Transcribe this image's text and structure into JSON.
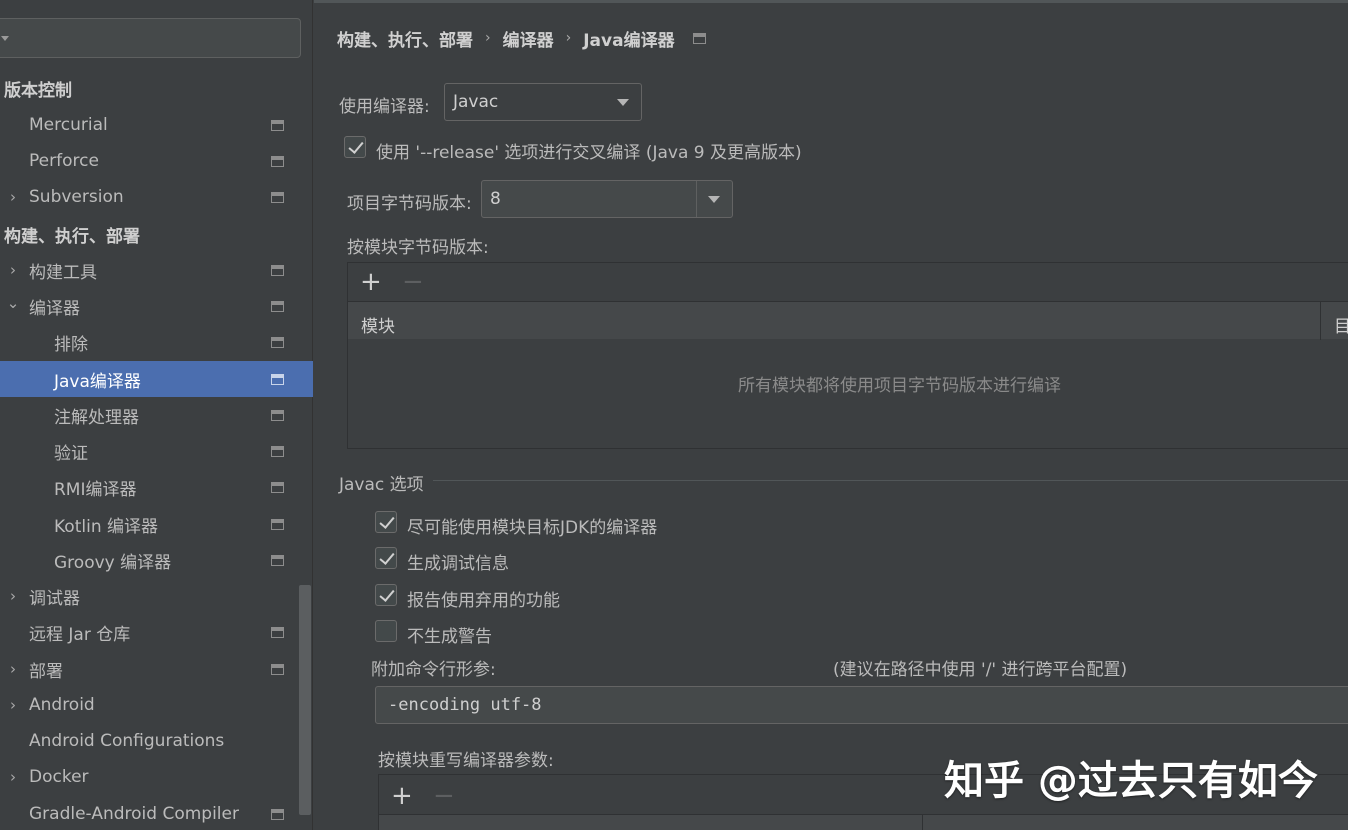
{
  "sidebar": {
    "items": [
      {
        "label": "版本控制",
        "section": true
      },
      {
        "label": "Mercurial"
      },
      {
        "label": "Perforce"
      },
      {
        "label": "Subversion",
        "arrow": "›"
      },
      {
        "label": "构建、执行、部署",
        "section": true
      },
      {
        "label": "构建工具",
        "arrow": "›"
      },
      {
        "label": "编译器",
        "arrow": "⌄"
      },
      {
        "label": "排除"
      },
      {
        "label": "Java编译器",
        "selected": true
      },
      {
        "label": "注解处理器"
      },
      {
        "label": "验证"
      },
      {
        "label": "RMI编译器"
      },
      {
        "label": "Kotlin 编译器"
      },
      {
        "label": "Groovy 编译器"
      },
      {
        "label": "调试器",
        "arrow": "›"
      },
      {
        "label": "远程 Jar 仓库"
      },
      {
        "label": "部署",
        "arrow": "›"
      },
      {
        "label": "Android",
        "arrow": "›"
      },
      {
        "label": "Android Configurations"
      },
      {
        "label": "Docker",
        "arrow": "›"
      },
      {
        "label": "Gradle-Android Compiler"
      }
    ]
  },
  "breadcrumb": {
    "part1": "构建、执行、部署",
    "part2": "编译器",
    "part3": "Java编译器"
  },
  "compiler": {
    "label": "使用编译器:",
    "value": "Javac"
  },
  "release_option": {
    "label": "使用 '--release' 选项进行交叉编译 (Java 9 及更高版本)",
    "checked": true
  },
  "bytecode": {
    "label": "项目字节码版本:",
    "value": "8"
  },
  "per_module": {
    "label": "按模块字节码版本:",
    "add": "+",
    "remove": "−",
    "col_module": "模块",
    "col_target": "目",
    "empty_text": "所有模块都将使用项目字节码版本进行编译"
  },
  "javac": {
    "group_title": "Javac 选项",
    "options": [
      {
        "label": "尽可能使用模块目标JDK的编译器",
        "checked": true
      },
      {
        "label": "生成调试信息",
        "checked": true
      },
      {
        "label": "报告使用弃用的功能",
        "checked": true
      },
      {
        "label": "不生成警告",
        "checked": false
      }
    ],
    "cmd_label": "附加命令行形参:",
    "cmd_hint": "(建议在路径中使用 '/' 进行跨平台配置)",
    "cmd_value": "-encoding utf-8",
    "override_label": "按模块重写编译器参数:",
    "add": "+",
    "remove": "−"
  },
  "watermark": "知乎 @过去只有如今",
  "colors": {
    "background": "#3c3f41",
    "selection": "#4b6eaf",
    "text": "#bbbbbb"
  }
}
